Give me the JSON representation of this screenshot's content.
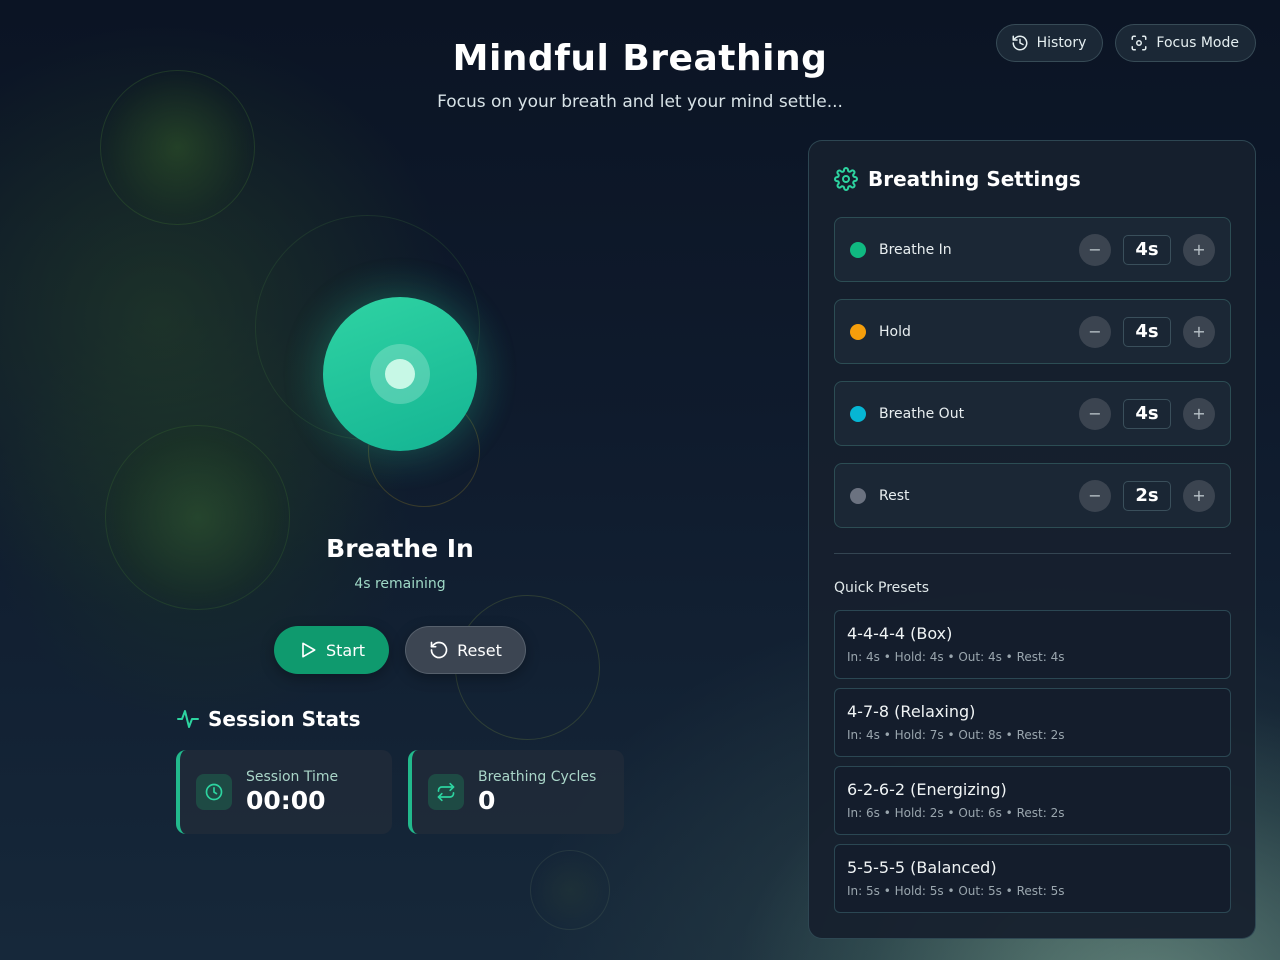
{
  "header": {
    "title": "Mindful Breathing",
    "subtitle": "Focus on your breath and let your mind settle..."
  },
  "top_actions": {
    "history_label": "History",
    "focus_mode_label": "Focus Mode"
  },
  "breathing": {
    "phase": "Breathe In",
    "remaining": "4s remaining",
    "start_label": "Start",
    "reset_label": "Reset"
  },
  "stats": {
    "heading": "Session Stats",
    "session_time_label": "Session Time",
    "session_time_value": "00:00",
    "cycles_label": "Breathing Cycles",
    "cycles_value": "0"
  },
  "settings": {
    "title": "Breathing Settings",
    "phases": [
      {
        "name": "Breathe In",
        "duration": "4s",
        "color": "#10b981"
      },
      {
        "name": "Hold",
        "duration": "4s",
        "color": "#f59e0b"
      },
      {
        "name": "Breathe Out",
        "duration": "4s",
        "color": "#06b6d4"
      },
      {
        "name": "Rest",
        "duration": "2s",
        "color": "#6b7280"
      }
    ],
    "presets_label": "Quick Presets",
    "presets": [
      {
        "name": "4-4-4-4 (Box)",
        "detail": "In: 4s • Hold: 4s • Out: 4s • Rest: 4s"
      },
      {
        "name": "4-7-8 (Relaxing)",
        "detail": "In: 4s • Hold: 7s • Out: 8s • Rest: 2s"
      },
      {
        "name": "6-2-6-2 (Energizing)",
        "detail": "In: 6s • Hold: 2s • Out: 6s • Rest: 2s"
      },
      {
        "name": "5-5-5-5 (Balanced)",
        "detail": "In: 5s • Hold: 5s • Out: 5s • Rest: 5s"
      }
    ]
  },
  "colors": {
    "accent": "#10b981",
    "start_button": "#0f9a6e",
    "reset_button": "#3c4552"
  }
}
